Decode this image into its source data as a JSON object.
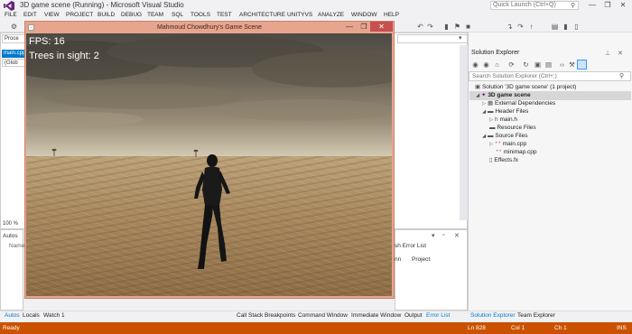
{
  "window": {
    "title": "3D game scene (Running) - Microsoft Visual Studio",
    "quick_launch_placeholder": "Quick Launch (Ctrl+Q)",
    "min_glyph": "—",
    "max_glyph": "❐",
    "close_glyph": "✕"
  },
  "menu": [
    "FILE",
    "EDIT",
    "VIEW",
    "PROJECT",
    "BUILD",
    "DEBUG",
    "TEAM",
    "SQL",
    "TOOLS",
    "TEST",
    "ARCHITECTURE",
    "UNITYVS",
    "ANALYZE",
    "WINDOW",
    "HELP"
  ],
  "editor": {
    "process_label": "Proce",
    "file_tab": "main.cpp",
    "scope_label": "(Glob",
    "zoom": "100 %"
  },
  "game": {
    "title": "Mahmoud Chowdhury's Game Scene",
    "fps": "FPS: 16",
    "trees": "Trees in sight: 2"
  },
  "autos": {
    "title": "Autos",
    "column_name": "Name"
  },
  "error_list": {
    "tab": "sh Error List",
    "col1": "nn",
    "col2": "Project"
  },
  "solution_explorer": {
    "title": "Solution Explorer",
    "search_placeholder": "Search Solution Explorer (Ctrl+;)",
    "items": [
      {
        "label": "Solution '3D game scene' (1 project)",
        "icon": "solution-icon",
        "arrow": ""
      },
      {
        "label": "3D game scene",
        "icon": "project-icon",
        "arrow": "◢"
      },
      {
        "label": "External Dependencies",
        "icon": "dependencies-icon",
        "arrow": "▷"
      },
      {
        "label": "Header Files",
        "icon": "folder-icon",
        "arrow": "◢"
      },
      {
        "label": "main.h",
        "icon": "header-file-icon",
        "arrow": "▷"
      },
      {
        "label": "Resource Files",
        "icon": "folder-icon",
        "arrow": ""
      },
      {
        "label": "Source Files",
        "icon": "folder-icon",
        "arrow": "◢"
      },
      {
        "label": "main.cpp",
        "icon": "cpp-file-icon",
        "arrow": "▷"
      },
      {
        "label": "minimap.cpp",
        "icon": "cpp-file-icon",
        "arrow": ""
      },
      {
        "label": "Effects.fx",
        "icon": "fx-file-icon",
        "arrow": ""
      }
    ]
  },
  "bottom_tabs_left": [
    "Autos",
    "Locals",
    "Watch 1"
  ],
  "bottom_tabs_mid": [
    "Call Stack",
    "Breakpoints",
    "Command Window",
    "Immediate Window",
    "Output",
    "Error List"
  ],
  "bottom_tabs_right": [
    "Solution Explorer",
    "Team Explorer"
  ],
  "status": {
    "state": "Ready",
    "line": "Ln 828",
    "col": "Col 1",
    "ch": "Ch 1",
    "mode": "INS"
  },
  "colors": {
    "status_bar": "#ca5100",
    "accent": "#007acc",
    "game_frame": "#e8a58e",
    "close_red": "#c75050"
  }
}
